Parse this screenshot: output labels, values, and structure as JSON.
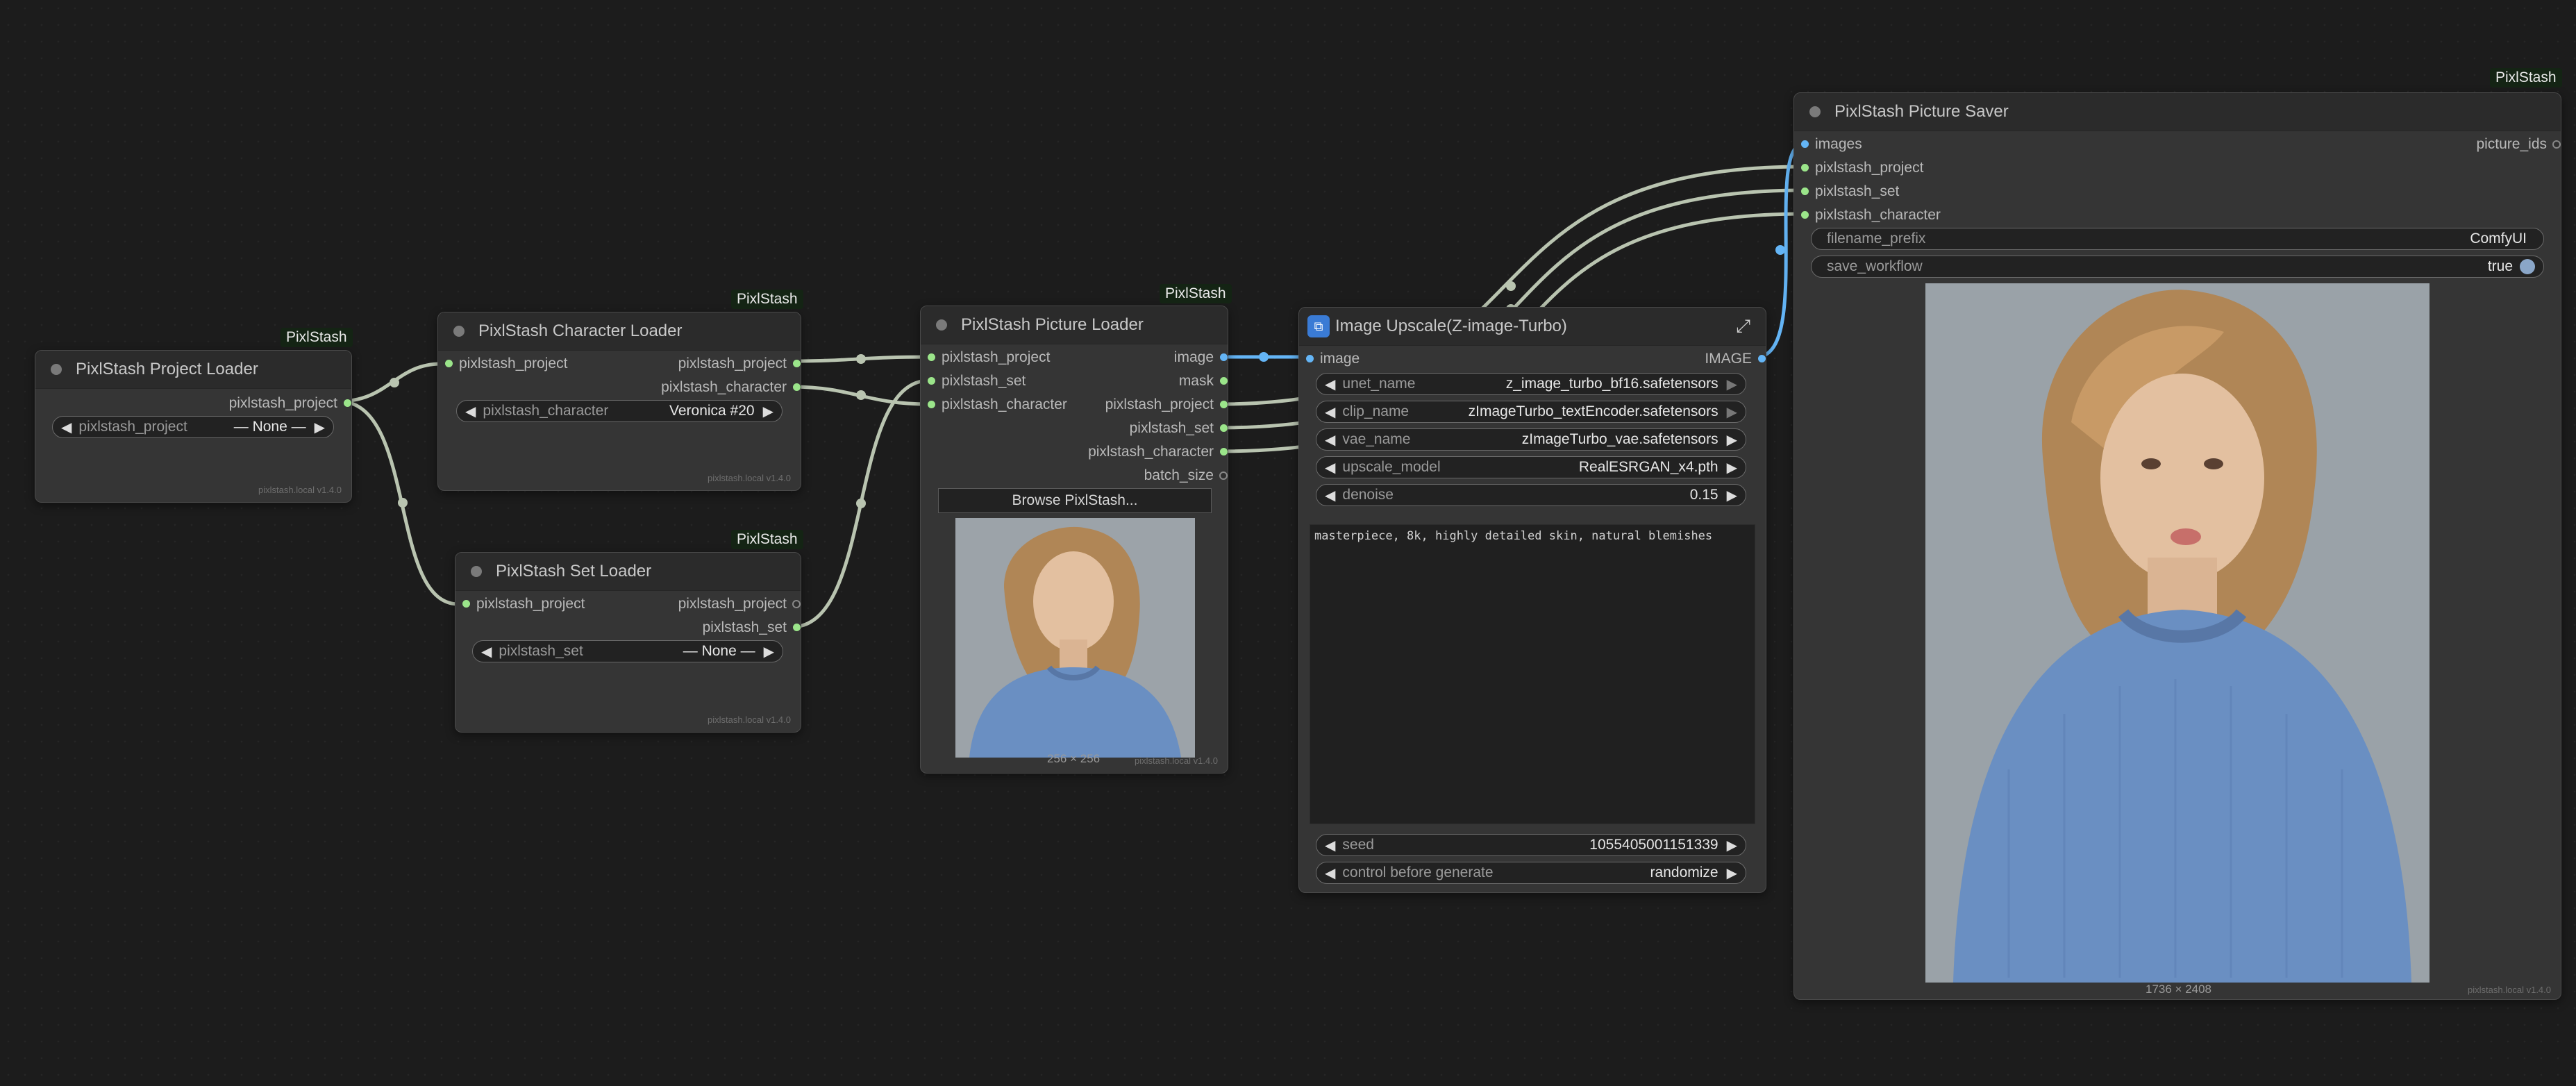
{
  "badge_label": "PixlStash",
  "footer_text": "pixlstash.local  v1.4.0",
  "colors": {
    "background": "#1c1c1c",
    "node": "#353535",
    "title_bar": "#2b2b2b",
    "string_slot": "#9be58a",
    "image_slot": "#64b5f6"
  },
  "project_loader": {
    "title": "PixlStash Project Loader",
    "out_project": "pixlstash_project",
    "widget_label": "pixlstash_project",
    "widget_value": "— None —"
  },
  "character_loader": {
    "title": "PixlStash Character Loader",
    "in_project": "pixlstash_project",
    "out_project": "pixlstash_project",
    "out_character": "pixlstash_character",
    "widget_label": "pixlstash_character",
    "widget_value": "Veronica #20"
  },
  "set_loader": {
    "title": "PixlStash Set Loader",
    "in_project": "pixlstash_project",
    "out_project": "pixlstash_project",
    "out_set": "pixlstash_set",
    "widget_label": "pixlstash_set",
    "widget_value": "— None —"
  },
  "picture_loader": {
    "title": "PixlStash Picture Loader",
    "in_project": "pixlstash_project",
    "in_set": "pixlstash_set",
    "in_character": "pixlstash_character",
    "out_image": "image",
    "out_mask": "mask",
    "out_project": "pixlstash_project",
    "out_set": "pixlstash_set",
    "out_character": "pixlstash_character",
    "out_batch_size": "batch_size",
    "browse_button": "Browse PixlStash...",
    "image_size": "256 × 256"
  },
  "upscale": {
    "title": "Image Upscale(Z-image-Turbo)",
    "in_image": "image",
    "out_image": "IMAGE",
    "widgets": [
      {
        "label": "unet_name",
        "value": "z_image_turbo_bf16.safetensors"
      },
      {
        "label": "clip_name",
        "value": "zImageTurbo_textEncoder.safetensors"
      },
      {
        "label": "vae_name",
        "value": "zImageTurbo_vae.safetensors"
      },
      {
        "label": "upscale_model",
        "value": "RealESRGAN_x4.pth"
      },
      {
        "label": "denoise",
        "value": "0.15"
      }
    ],
    "prompt": "masterpiece, 8k, highly detailed skin, natural blemishes",
    "seed_label": "seed",
    "seed_value": "1055405001151339",
    "control_label": "control before generate",
    "control_value": "randomize"
  },
  "saver": {
    "title": "PixlStash Picture Saver",
    "in_images": "images",
    "in_project": "pixlstash_project",
    "in_set": "pixlstash_set",
    "in_character": "pixlstash_character",
    "out_picture_ids": "picture_ids",
    "filename_prefix_label": "filename_prefix",
    "filename_prefix_value": "ComfyUI",
    "save_workflow_label": "save_workflow",
    "save_workflow_value": "true",
    "image_size": "1736 × 2408"
  }
}
